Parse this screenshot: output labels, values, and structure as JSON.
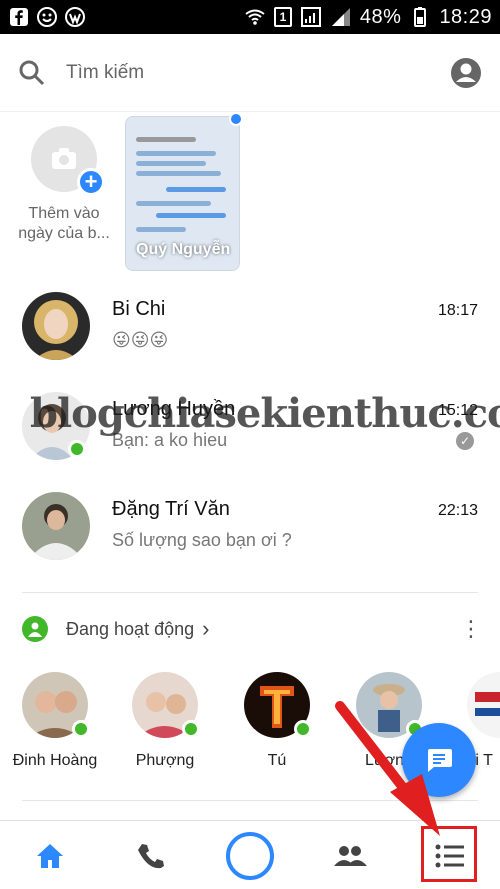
{
  "status_bar": {
    "battery": "48%",
    "time": "18:29",
    "sim_badge": "1"
  },
  "search": {
    "placeholder": "Tìm kiếm"
  },
  "stories": {
    "add_label": "Thêm vào ngày của b...",
    "items": [
      {
        "name": "Quý Nguyễn"
      }
    ]
  },
  "conversations": [
    {
      "name": "Bi Chi",
      "message": "😜😜😜",
      "time": "18:17",
      "online": false
    },
    {
      "name": "Lương Huyền",
      "message": "Bạn: a ko hieu",
      "time": "15:12",
      "online": true,
      "seen": true
    },
    {
      "name": "Đặng Trí Văn",
      "message": "Số lượng sao bạn ơi ?",
      "time": "22:13",
      "online": false
    }
  ],
  "active_now": {
    "label": "Đang hoạt động",
    "people": [
      {
        "name": "Đinh Hoàng"
      },
      {
        "name": "Phượng"
      },
      {
        "name": "Tú"
      },
      {
        "name": "Lương"
      },
      {
        "name": "Vi T"
      }
    ]
  },
  "watermark": "blogchiasekienthuc.com",
  "bottom_nav": {
    "items": [
      "home-icon",
      "phone-icon",
      "camera-icon",
      "people-icon",
      "menu-list-icon"
    ]
  },
  "colors": {
    "accent": "#2d88ff",
    "online": "#42b72a",
    "annotation": "#e02020"
  }
}
